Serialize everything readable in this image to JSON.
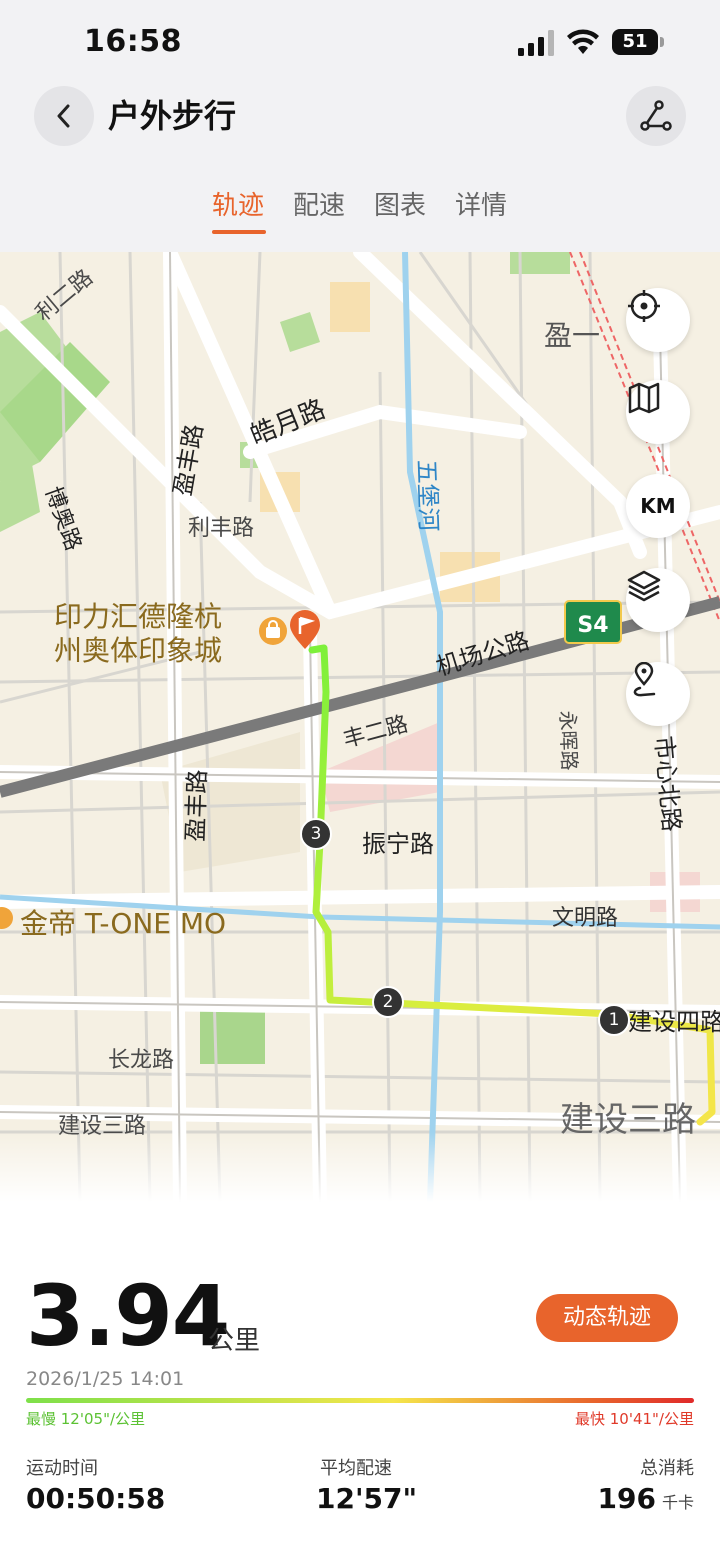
{
  "status_bar": {
    "time": "16:58",
    "battery": "51"
  },
  "header": {
    "title": "户外步行",
    "back_icon": "chevron-left-icon",
    "route_icon": "route-share-icon"
  },
  "tabs": [
    {
      "label": "轨迹",
      "active": true
    },
    {
      "label": "配速",
      "active": false
    },
    {
      "label": "图表",
      "active": false
    },
    {
      "label": "详情",
      "active": false
    }
  ],
  "map": {
    "streets": {
      "li_er": "利二路",
      "ying_yi": "盈一",
      "hao_yue": "皓月路",
      "ying_feng_top": "盈丰路",
      "bo_ao": "博奥路",
      "li_feng": "利丰路",
      "wu_bao_river": "五堡河",
      "airport_road": "机场公路",
      "feng_er": "丰二路",
      "yong_hui": "永晖路",
      "shi_xin_north": "市心北路",
      "ying_feng_mid": "盈丰路",
      "zhen_ning": "振宁路",
      "wen_ming": "文明路",
      "jian_she_si": "建设四路",
      "chang_long": "长龙路",
      "jian_she_san_left": "建设三路",
      "jian_she_san_right": "建设三路"
    },
    "pois": {
      "yinli": "印力汇德隆杭州奥体印象城",
      "yinli_line1": "印力汇德隆杭",
      "yinli_line2": "州奥体印象城",
      "jindi": "金帝 T-ONE MO"
    },
    "highway_badge": {
      "label": "S4",
      "color": "#1f8a4c"
    },
    "km_markers": [
      "1",
      "2",
      "3"
    ],
    "controls": {
      "locate_icon": "locate-icon",
      "map_icon": "map-icon",
      "km_label": "KM",
      "layers_icon": "layers-icon",
      "poi_icon": "route-pin-icon"
    }
  },
  "summary": {
    "distance": "3.94",
    "distance_unit": "公里",
    "dynamic_button": "动态轨迹",
    "datetime": "2026/1/25 14:01",
    "slowest": "最慢 12'05\"/公里",
    "fastest": "最快 10'41\"/公里"
  },
  "stats": {
    "duration_label": "运动时间",
    "duration_value": "00:50:58",
    "pace_label": "平均配速",
    "pace_value": "12'57\"",
    "calories_label": "总消耗",
    "calories_value": "196",
    "calories_unit": "千卡"
  },
  "colors": {
    "accent": "#e8642c",
    "route_start": "#f2e04a",
    "route_end": "#7ef03a"
  }
}
